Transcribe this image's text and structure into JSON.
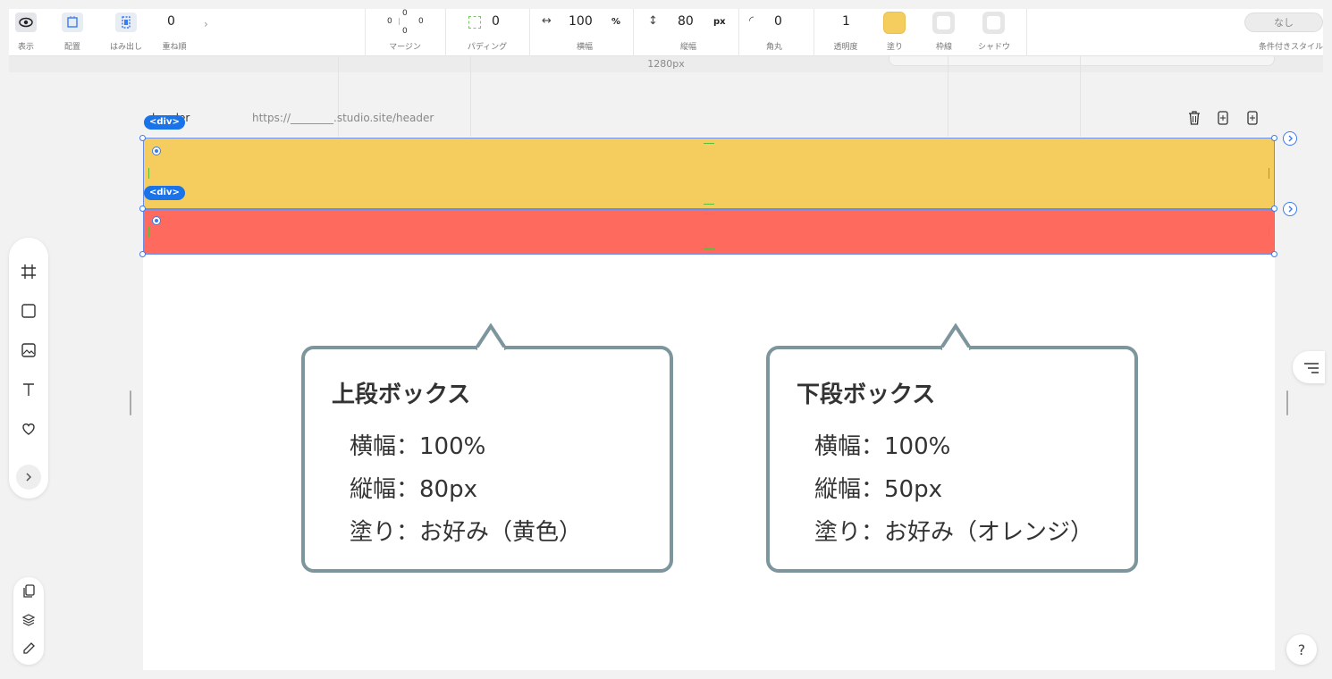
{
  "toolbar": {
    "view_label": "表示",
    "layout_label": "配置",
    "overflow_label": "はみ出し",
    "order_value": "0",
    "order_label": "重ね順",
    "margin_top": "0",
    "margin_left": "0",
    "margin_right": "0",
    "margin_bottom": "0",
    "margin_label": "マージン",
    "padding_value": "0",
    "padding_label": "パディング",
    "width_value": "100",
    "width_unit": "%",
    "width_label": "横幅",
    "height_value": "80",
    "height_unit": "px",
    "height_label": "縦幅",
    "radius_value": "0",
    "radius_label": "角丸",
    "opacity_value": "1",
    "opacity_label": "透明度",
    "fill_label": "塗り",
    "fill_color": "#f5cd5f",
    "border_label": "枠線",
    "shadow_label": "シャドウ",
    "condition_value": "なし",
    "condition_label": "条件付きスタイル"
  },
  "ruler": {
    "width_label": "1280px"
  },
  "frame": {
    "name": "header",
    "url": "https://________.studio.site/header"
  },
  "elements": {
    "top_badge": "<div>",
    "bottom_badge": "<div>",
    "top_color": "#f5cd5f",
    "bottom_color": "#fe6a5e"
  },
  "callouts": [
    {
      "title": "上段ボックス",
      "lines": [
        "横幅：100%",
        "縦幅：80px",
        "塗り：お好み（黄色）"
      ]
    },
    {
      "title": "下段ボックス",
      "lines": [
        "横幅：100%",
        "縦幅：50px",
        "塗り：お好み（オレンジ）"
      ]
    }
  ],
  "help": {
    "label": "?"
  },
  "icons": [
    "eye-icon",
    "layout-icon",
    "overflow-icon",
    "trash-icon",
    "duplicate-icon",
    "add-icon",
    "frame-icon",
    "rect-icon",
    "image-icon",
    "text-icon",
    "heart-icon",
    "chevron-right-icon",
    "pages-icon",
    "layers-icon",
    "pen-icon",
    "outline-icon"
  ]
}
